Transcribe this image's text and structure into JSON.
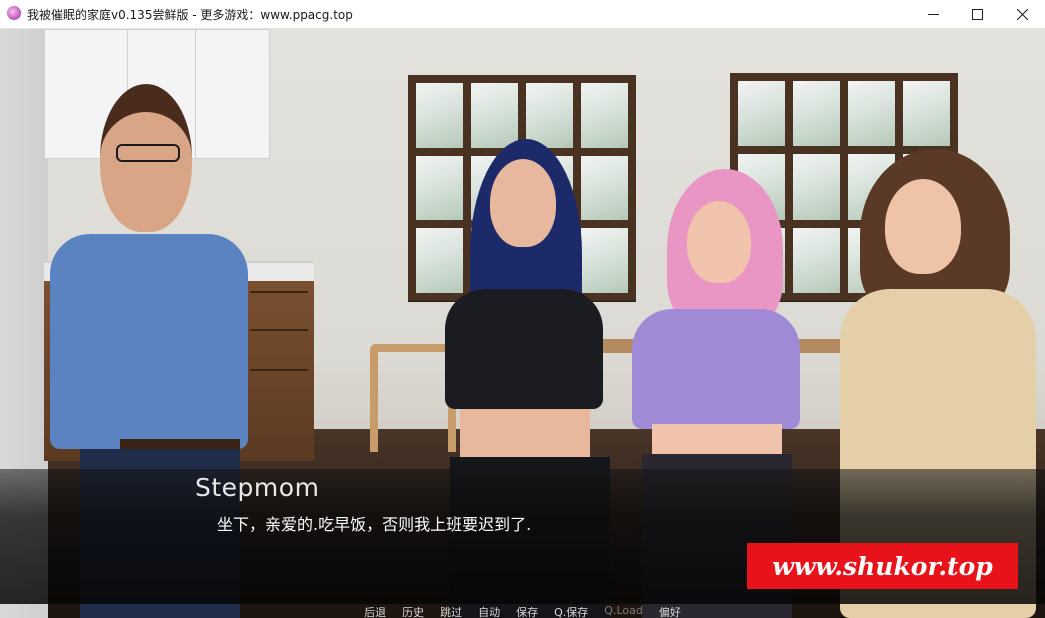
{
  "window": {
    "title": "我被催眠的家庭v0.135尝鲜版 - 更多游戏：www.ppacg.top",
    "icon": "app-icon",
    "controls": [
      "minimize-icon",
      "maximize-icon",
      "close-icon"
    ]
  },
  "dialogue": {
    "speaker": "Stepmom",
    "text": "坐下，亲爱的.吃早饭，否则我上班要迟到了."
  },
  "quick_menu": {
    "items": [
      {
        "label": "后退",
        "enabled": true
      },
      {
        "label": "历史",
        "enabled": true
      },
      {
        "label": "跳过",
        "enabled": true
      },
      {
        "label": "自动",
        "enabled": true
      },
      {
        "label": "保存",
        "enabled": true
      },
      {
        "label": "Q.保存",
        "enabled": true
      },
      {
        "label": "Q.Load",
        "enabled": false
      },
      {
        "label": "偏好",
        "enabled": true
      }
    ]
  },
  "watermark": {
    "text": "www.shukor.top",
    "color": "#e8131a"
  },
  "colors": {
    "dialogue_text": "#ffffff",
    "speaker_name": "#e8e8e8",
    "quick_menu_text": "#d8d8d8",
    "quick_menu_disabled": "#7a7a7a"
  }
}
